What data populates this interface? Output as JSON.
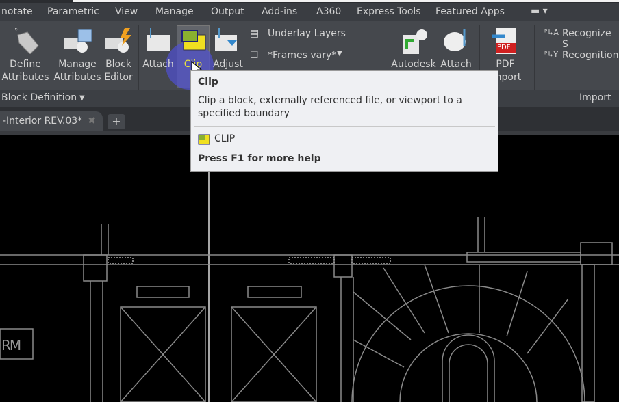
{
  "menu": [
    "notate",
    "Parametric",
    "View",
    "Manage",
    "Output",
    "Add-ins",
    "A360",
    "Express Tools",
    "Featured Apps"
  ],
  "ribbon": {
    "define_attributes": [
      "Define",
      "Attributes"
    ],
    "manage_attributes": [
      "Manage",
      "Attributes"
    ],
    "block_editor": [
      "Block",
      "Editor"
    ],
    "attach": "Attach",
    "clip": "Clip",
    "adjust": "Adjust",
    "underlay_layers": "Underlay Layers",
    "frames": "*Frames vary*",
    "autodesk": "Autodesk",
    "attach2": "Attach",
    "pdf_import": [
      "PDF",
      "Import"
    ],
    "recognize": "Recognize S",
    "recognition": "Recognition",
    "pdf_badge": "PDF"
  },
  "panels": {
    "block_definition": "Block Definition",
    "import": "Import"
  },
  "file_tab": "-Interior REV.03*",
  "new_tab": "+",
  "tooltip": {
    "title": "Clip",
    "description": "Clip a block, externally referenced file, or viewport to a specified boundary",
    "command": "CLIP",
    "help": "Press F1 for more help"
  },
  "drawing": {
    "room_label": "RM"
  },
  "colors": {
    "highlight": "#f0e020",
    "cursor_ring": "#5050d0",
    "ribbon": "#45484d"
  }
}
